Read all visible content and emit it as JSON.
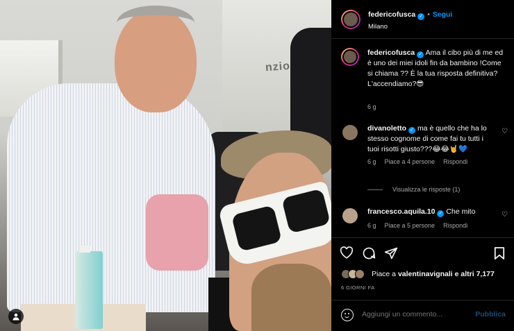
{
  "post": {
    "username": "federicofusca",
    "follow_label": "Segui",
    "separator": "•",
    "location": "Milano",
    "photo_sign_text": "nzio"
  },
  "comments": [
    {
      "username": "federicofusca",
      "text": "Ama il cibo più di me ed è uno dei miei idoli fin da bambino !Come si chiama ?? È la tua risposta definitiva? L'accendiamo?😎",
      "time": "6 g"
    },
    {
      "username": "divanoletto",
      "text": "ma è quello che ha lo stesso cognome di come fai tu tutti i tuoi risotti giusto???😂😂🤘💙",
      "time": "6 g",
      "likes": "Piace a 4 persone",
      "reply": "Rispondi"
    },
    {
      "username": "francesco.aquila.10",
      "text": "Che mito",
      "time": "6 g",
      "likes": "Piace a 5 persone",
      "reply": "Rispondi"
    }
  ],
  "view_replies": "Visualizza le risposte (1)",
  "likes_line": {
    "prefix": "Piace a",
    "user": "valentinavignali",
    "suffix": "e altri 7,177"
  },
  "date": "6 GIORNI FA",
  "add_comment": {
    "placeholder": "Aggiungi un commento...",
    "publish": "Pubblica"
  },
  "icons": {
    "verified": "verified-badge-icon",
    "like": "heart-icon",
    "comment": "comment-icon",
    "share": "share-icon",
    "save": "bookmark-icon",
    "emoji": "emoji-icon",
    "tag": "user-tag-icon"
  },
  "colors": {
    "accent": "#0095f6",
    "background": "#000000",
    "text": "#f5f5f5",
    "muted": "#a8a8a8",
    "publish_disabled": "#1c4e78"
  }
}
